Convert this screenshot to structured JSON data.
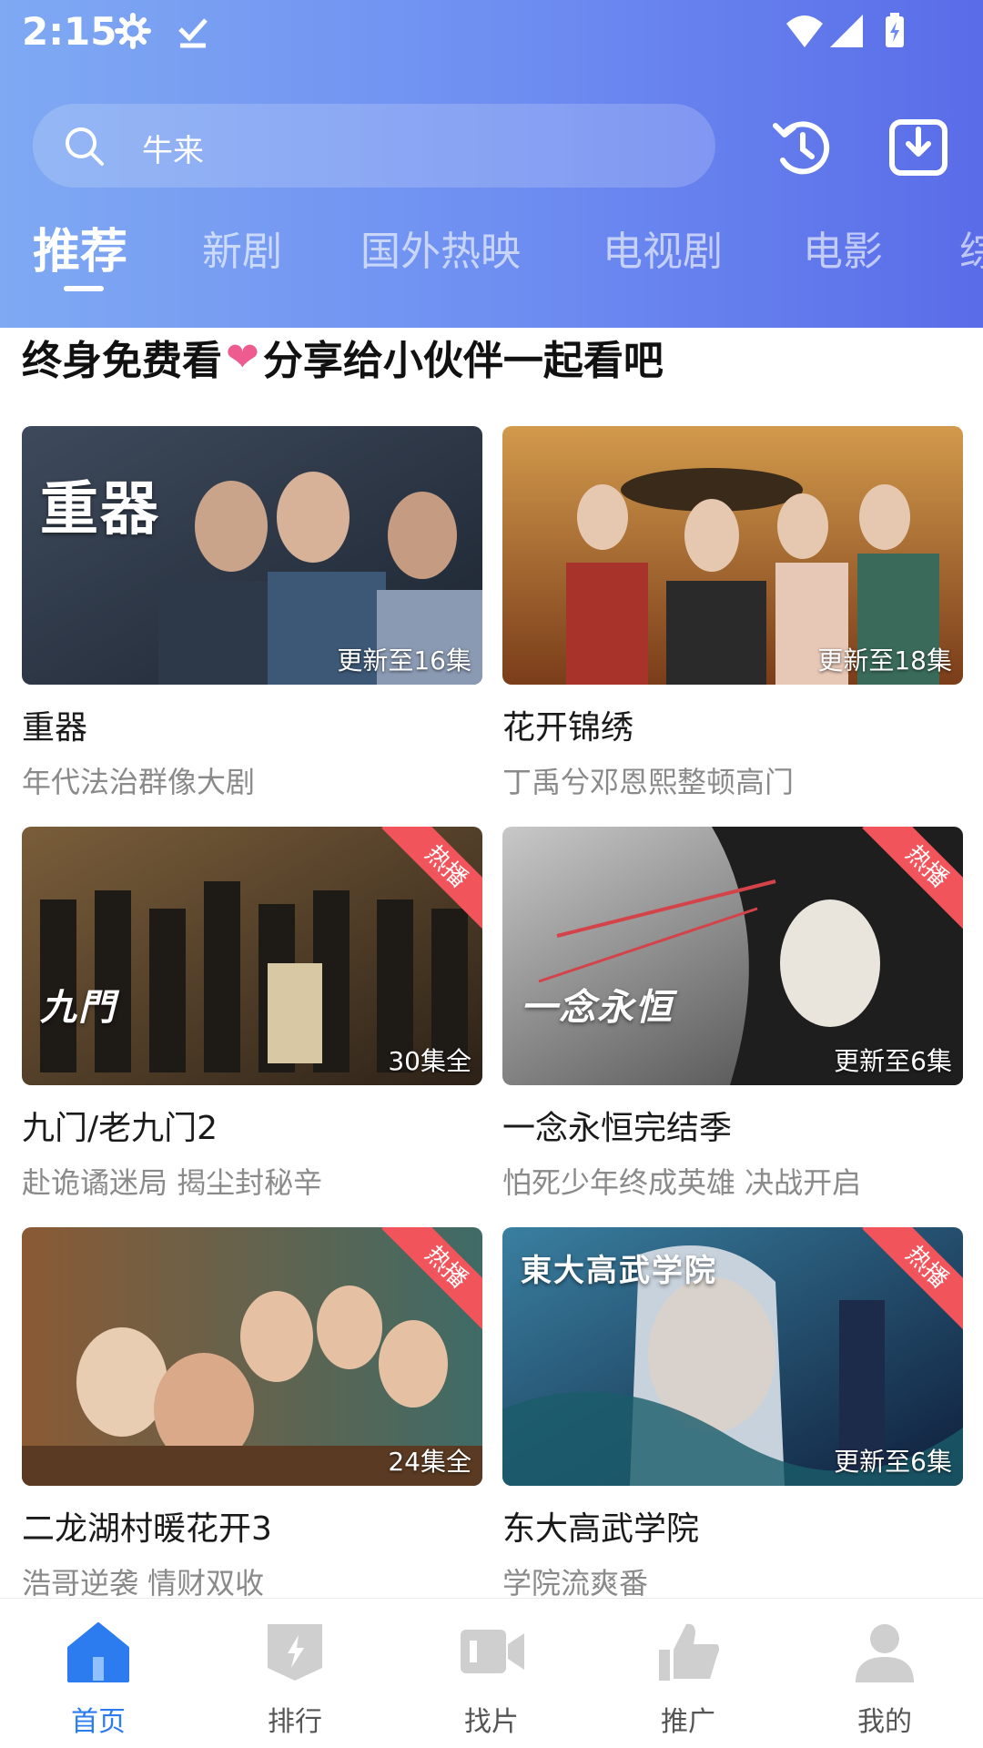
{
  "status": {
    "time": "2:15"
  },
  "search": {
    "text": "牛来"
  },
  "tabs": [
    "推荐",
    "新剧",
    "国外热映",
    "电视剧",
    "电影",
    "综"
  ],
  "promo": {
    "text_before": "终身免费看",
    "text_after": "分享给小伙伴一起看吧"
  },
  "cards": [
    {
      "title": "重器",
      "subtitle": "年代法治群像大剧",
      "badge": "更新至16集",
      "hot": "",
      "caption": "重器",
      "colors": [
        "#3e4a5c",
        "#1c2430"
      ]
    },
    {
      "title": "花开锦绣",
      "subtitle": "丁禹兮邓恩熙整顿高门",
      "badge": "更新至18集",
      "hot": "",
      "caption": "",
      "colors": [
        "#c98b3a",
        "#7a3d1a"
      ]
    },
    {
      "title": "九门/老九门2",
      "subtitle": "赴诡谲迷局 揭尘封秘辛",
      "badge": "30集全",
      "hot": "热播",
      "caption": "九門",
      "colors": [
        "#6a5234",
        "#2c2118"
      ]
    },
    {
      "title": "一念永恒完结季",
      "subtitle": "怕死少年终成英雄 决战开启",
      "badge": "更新至6集",
      "hot": "热播",
      "caption": "一念永恒",
      "colors": [
        "#9a9a9a",
        "#3a3a3a"
      ]
    },
    {
      "title": "二龙湖村暖花开3",
      "subtitle": "浩哥逆袭 情财双收",
      "badge": "24集全",
      "hot": "热播",
      "caption": "",
      "colors": [
        "#3f6b66",
        "#7a4a2a"
      ]
    },
    {
      "title": "东大高武学院",
      "subtitle": "学院流爽番",
      "badge": "更新至6集",
      "hot": "热播",
      "caption": "東大高武学院",
      "colors": [
        "#2a5d7a",
        "#0e1e3a"
      ]
    }
  ],
  "nav": [
    {
      "label": "首页",
      "icon": "home-icon",
      "active": true
    },
    {
      "label": "排行",
      "icon": "ranking-icon",
      "active": false
    },
    {
      "label": "找片",
      "icon": "video-camera-icon",
      "active": false
    },
    {
      "label": "推广",
      "icon": "thumbs-up-icon",
      "active": false
    },
    {
      "label": "我的",
      "icon": "user-icon",
      "active": false
    }
  ],
  "accent": "#2c7cf0"
}
